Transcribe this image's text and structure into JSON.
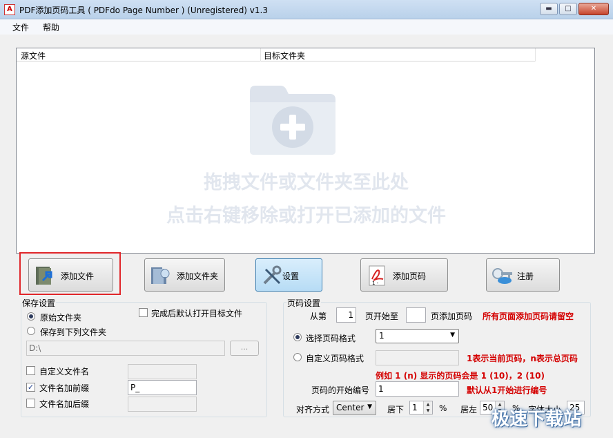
{
  "window": {
    "title": "PDF添加页码工具 ( PDFdo Page Number ) (Unregistered) v1.3",
    "app_icon": "pdf-icon",
    "controls": [
      "minimize",
      "maximize",
      "close"
    ]
  },
  "menu": {
    "items": [
      "文件",
      "帮助"
    ]
  },
  "file_list": {
    "columns": [
      "源文件",
      "目标文件夹"
    ],
    "hint_line1": "拖拽文件或文件夹至此处",
    "hint_line2": "点击右键移除或打开已添加的文件"
  },
  "buttons": {
    "add_file": "添加文件",
    "add_folder": "添加文件夹",
    "settings": "设置",
    "add_page_number": "添加页码",
    "register": "注册"
  },
  "save_settings": {
    "title": "保存设置",
    "original_folder": "原始文件夹",
    "save_to_folder": "保存到下列文件夹",
    "open_after": "完成后默认打开目标文件",
    "folder_path": "D:\\",
    "browse_label": "...",
    "custom_filename": "自定义文件名",
    "custom_filename_value": "",
    "add_prefix": "文件名加前缀",
    "prefix_value": "P_",
    "add_suffix": "文件名加后缀",
    "suffix_value": ""
  },
  "page_settings": {
    "title": "页码设置",
    "from_label": "从第",
    "from_value": "1",
    "start_to_label": "页开始至",
    "to_value": "",
    "add_label": "页添加页码",
    "all_hint": "所有页面添加页码请留空",
    "select_format": "选择页码格式",
    "format_value": "1",
    "custom_format": "自定义页码格式",
    "custom_format_value": "",
    "format_hint1": "1表示当前页码，n表示总页码",
    "format_hint2": "例如 1 (n) 显示的页码会是 1 (10)，2 (10)",
    "start_number_label": "页码的开始编号",
    "start_number_value": "1",
    "start_hint": "默认从1开始进行编号",
    "align_label": "对齐方式",
    "align_value": "Center",
    "bottom_label": "居下",
    "bottom_value": "1",
    "percent": "%",
    "left_label": "居左",
    "left_value": "50",
    "percent2": "%",
    "font_size_label": "字体大小",
    "font_size_value": "25"
  },
  "watermark": "极速下载站",
  "colors": {
    "accent_red": "#d40000",
    "highlight": "#e0262a",
    "selected_button": "#b7dcf5"
  }
}
